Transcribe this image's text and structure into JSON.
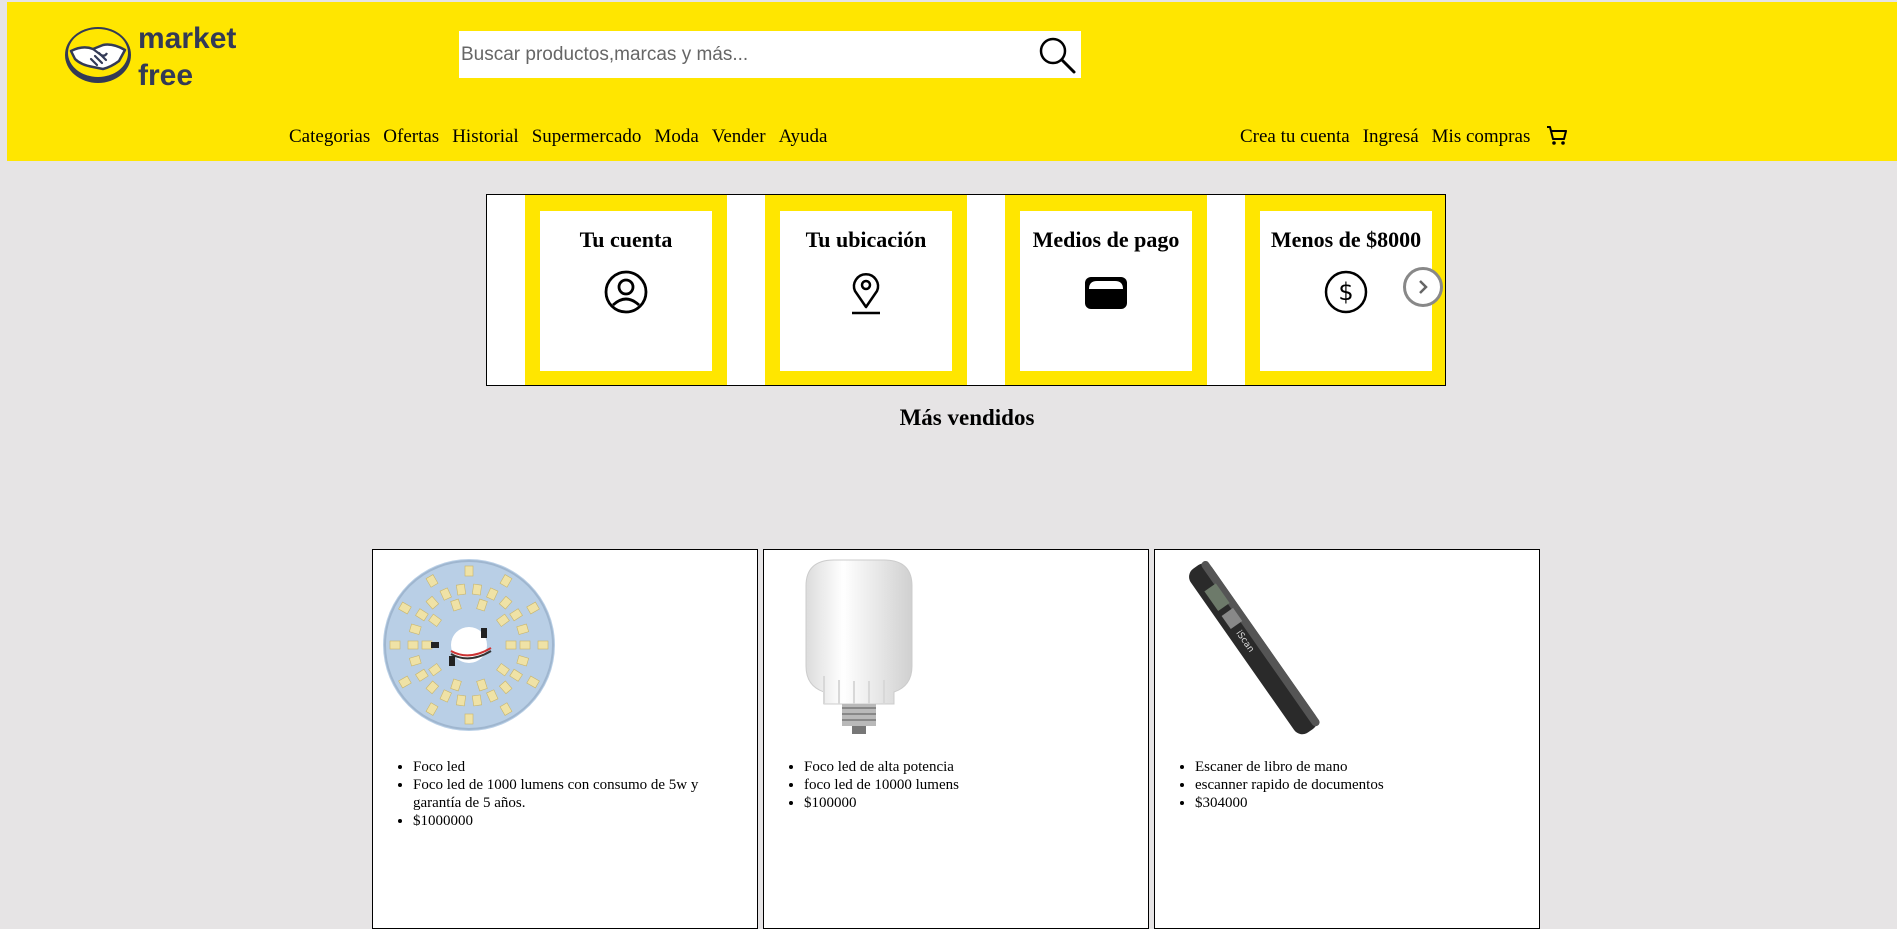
{
  "header": {
    "logo_text": "market\nfree",
    "search_placeholder": "Buscar productos,marcas y más...",
    "nav_left": [
      "Categorias",
      "Ofertas",
      "Historial",
      "Supermercado",
      "Moda",
      "Vender",
      "Ayuda"
    ],
    "nav_right": [
      "Crea tu cuenta",
      "Ingresá",
      "Mis compras"
    ],
    "brand_color": "#ffe600"
  },
  "carousel": {
    "cards": [
      {
        "title": "Tu cuenta",
        "icon": "user-circle-icon"
      },
      {
        "title": "Tu ubicación",
        "icon": "location-pin-icon"
      },
      {
        "title": "Medios de pago",
        "icon": "wallet-icon"
      },
      {
        "title": "Menos de $8000",
        "icon": "dollar-circle-icon"
      }
    ]
  },
  "section_title": "Más vendidos",
  "products": [
    {
      "items": [
        "Foco led",
        "Foco led de 1000 lumens con consumo de 5w y garantía de 5 años.",
        "$1000000"
      ],
      "image": "led-plate-image"
    },
    {
      "items": [
        "Foco led de alta potencia",
        "foco led de 10000 lumens",
        "$100000"
      ],
      "image": "led-bulb-image"
    },
    {
      "items": [
        "Escaner de libro de mano",
        "escanner rapido de documentos",
        "$304000"
      ],
      "image": "handheld-scanner-image"
    }
  ]
}
